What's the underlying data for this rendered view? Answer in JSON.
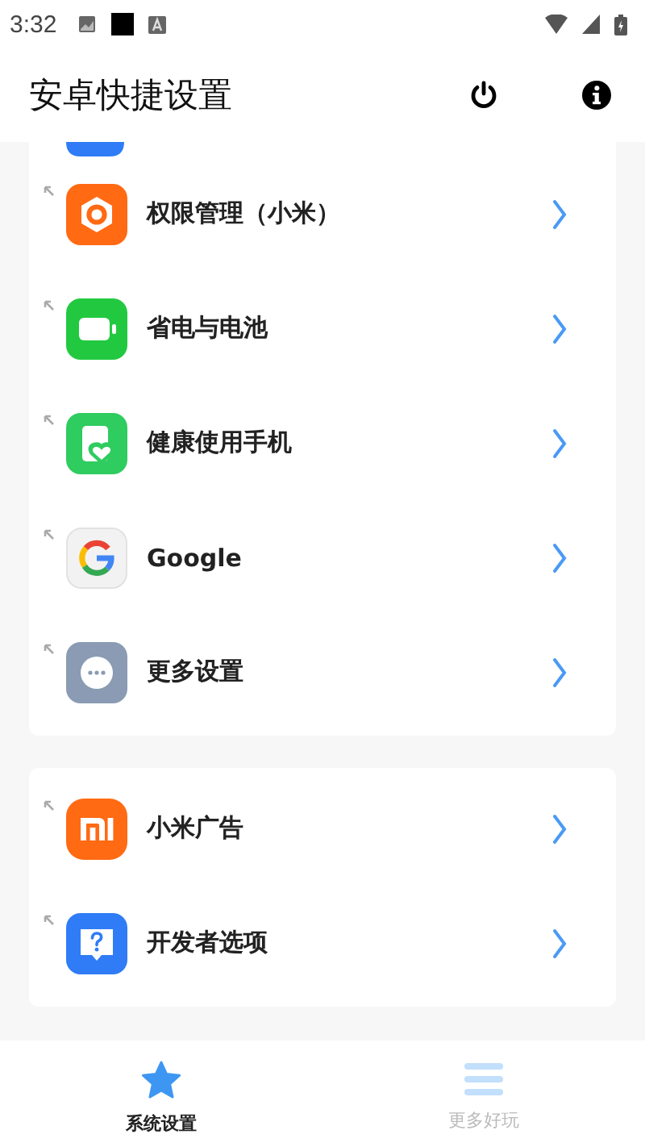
{
  "status_bar": {
    "time": "3:32"
  },
  "app_bar": {
    "title": "安卓快捷设置"
  },
  "cards": [
    {
      "partial_top": true,
      "items": [
        {
          "kind": "permissions",
          "label": "权限管理（小米）"
        },
        {
          "kind": "battery",
          "label": "省电与电池"
        },
        {
          "kind": "wellbeing",
          "label": "健康使用手机"
        },
        {
          "kind": "google",
          "label": "Google"
        },
        {
          "kind": "more",
          "label": "更多设置"
        }
      ]
    },
    {
      "partial_top": false,
      "items": [
        {
          "kind": "mi",
          "label": "小米广告"
        },
        {
          "kind": "developer",
          "label": "开发者选项"
        }
      ]
    }
  ],
  "bottom_nav": [
    {
      "kind": "star",
      "label": "系统设置",
      "selected": true
    },
    {
      "kind": "list",
      "label": "更多好玩",
      "selected": false
    }
  ]
}
